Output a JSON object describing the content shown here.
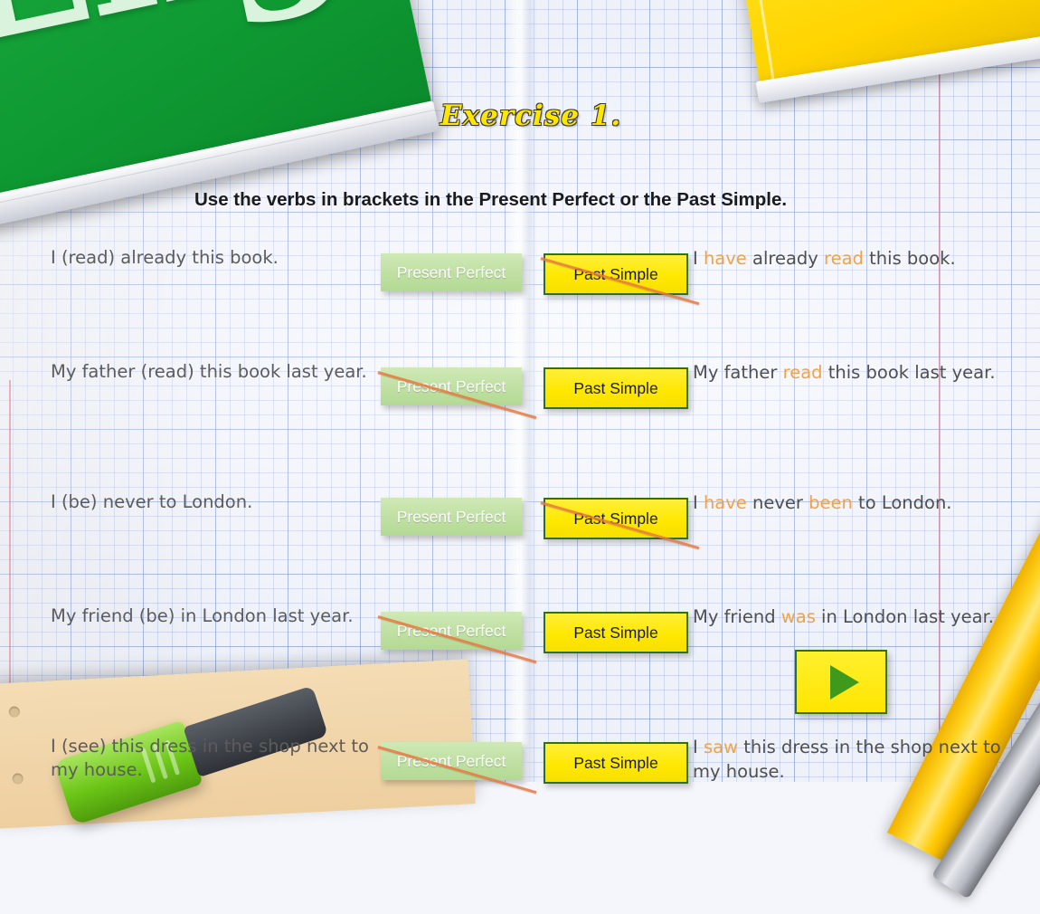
{
  "exercise": {
    "title": "Exercise 1.",
    "instruction": "Use the verbs in brackets in the Present Perfect or the Past Simple."
  },
  "buttons": {
    "present_perfect": "Present Perfect",
    "past_simple": "Past Simple",
    "next_icon": "play-triangle-icon"
  },
  "decor": {
    "green_book_title": "Eng",
    "objects": [
      "green-book",
      "yellow-book",
      "pencil",
      "pen",
      "beige-note",
      "green-highlighter"
    ]
  },
  "rows": [
    {
      "question": "I (read) already this book.",
      "crossed": "past_simple",
      "answer_parts": [
        {
          "t": "I ",
          "hl": false
        },
        {
          "t": "have",
          "hl": true
        },
        {
          "t": " already ",
          "hl": false
        },
        {
          "t": "read",
          "hl": true
        },
        {
          "t": " this book.",
          "hl": false
        }
      ]
    },
    {
      "question": "My father (read) this book last year.",
      "crossed": "present_perfect",
      "answer_parts": [
        {
          "t": "My father ",
          "hl": false
        },
        {
          "t": "read",
          "hl": true
        },
        {
          "t": " this book last year.",
          "hl": false
        }
      ]
    },
    {
      "question": "I (be) never to London.",
      "crossed": "past_simple",
      "answer_parts": [
        {
          "t": "I ",
          "hl": false
        },
        {
          "t": "have",
          "hl": true
        },
        {
          "t": " never ",
          "hl": false
        },
        {
          "t": "been",
          "hl": true
        },
        {
          "t": " to London.",
          "hl": false
        }
      ]
    },
    {
      "question": "My friend (be) in London last year.",
      "crossed": "present_perfect",
      "answer_parts": [
        {
          "t": "My friend ",
          "hl": false
        },
        {
          "t": "was",
          "hl": true
        },
        {
          "t": " in London last year.",
          "hl": false
        }
      ]
    },
    {
      "question": "I (see) this dress in the shop next to my house.",
      "crossed": "present_perfect",
      "answer_parts": [
        {
          "t": "I ",
          "hl": false
        },
        {
          "t": "saw",
          "hl": true
        },
        {
          "t": " this dress in the shop next to my house.",
          "hl": false
        }
      ]
    }
  ],
  "colors": {
    "accent_yellow": "#ffe800",
    "green_button": "#bfe0a2",
    "green_border": "#2f6f1d",
    "answer_highlight": "#f0a24a",
    "strike": "#e8793f",
    "question_text": "#5c5c5c"
  }
}
